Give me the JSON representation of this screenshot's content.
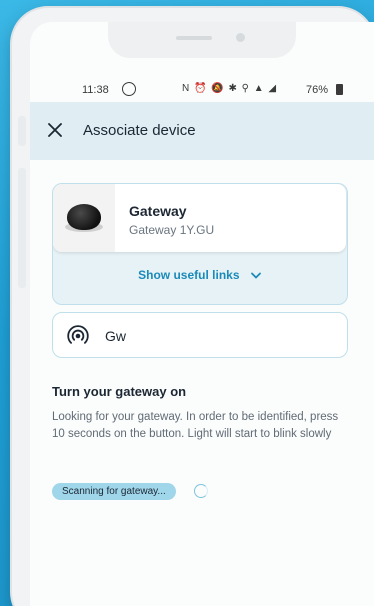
{
  "status_bar": {
    "time": "11:38",
    "icons": "N ⏰ 🔕 ✱ ⚲ ▲ ◢",
    "battery": "76%"
  },
  "header": {
    "close_icon": "close-icon",
    "title": "Associate device"
  },
  "device": {
    "name": "Gateway",
    "subtitle": "Gateway 1Y.GU",
    "links_label": "Show useful links"
  },
  "gateway_field": {
    "icon": "signal-icon",
    "value": "Gw"
  },
  "instructions": {
    "title": "Turn your gateway on",
    "body": "Looking for your gateway. In order to be identified, press 10 seconds on the button. Light will start to blink slowly"
  },
  "scan": {
    "badge": "Scanning for gateway..."
  },
  "colors": {
    "background": "#21a4d8",
    "accent": "#1b8ab9",
    "header_bg": "#e0eef3",
    "badge_bg": "#9fd6ea"
  }
}
